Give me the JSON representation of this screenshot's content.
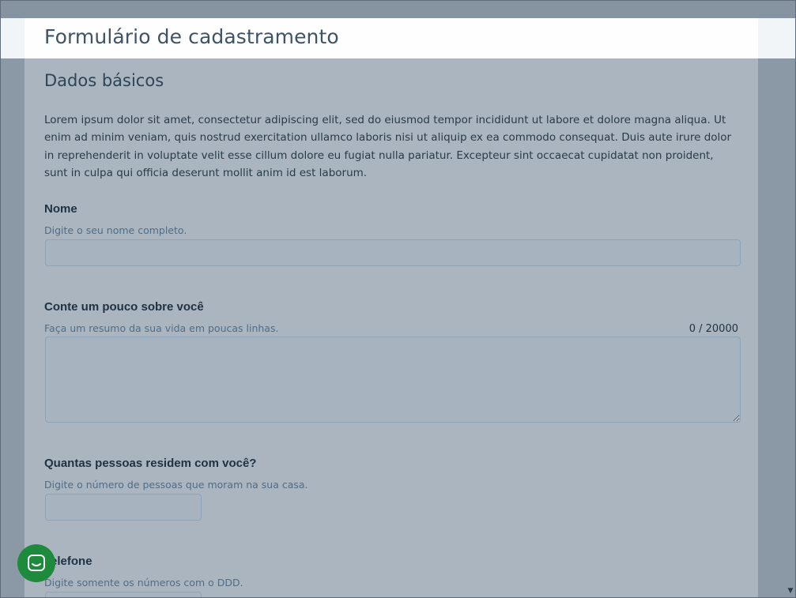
{
  "header": {
    "title": "Formulário de cadastramento"
  },
  "section": {
    "title": "Dados básicos",
    "intro": "Lorem ipsum dolor sit amet, consectetur adipiscing elit, sed do eiusmod tempor incididunt ut labore et dolore magna aliqua. Ut enim ad minim veniam, quis nostrud exercitation ullamco laboris nisi ut aliquip ex ea commodo consequat. Duis aute irure dolor in reprehenderit in voluptate velit esse cillum dolore eu fugiat nulla pariatur. Excepteur sint occaecat cupidatat non proident, sunt in culpa qui officia deserunt mollit anim id est laborum."
  },
  "fields": {
    "nome": {
      "label": "Nome",
      "help": "Digite o seu nome completo.",
      "value": ""
    },
    "sobre": {
      "label": "Conte um pouco sobre você",
      "help": "Faça um resumo da sua vida em poucas linhas.",
      "value": "",
      "counter": "0 / 20000"
    },
    "pessoas": {
      "label": "Quantas pessoas residem com você?",
      "help": "Digite o número de pessoas que moram na sua casa.",
      "value": ""
    },
    "telefone": {
      "label": "Telefone",
      "help": "Digite somente os números com o DDD.",
      "value": ""
    }
  },
  "icons": {
    "chat": "chat-bubble-icon",
    "scroll_down": "arrow-down-icon"
  },
  "colors": {
    "chat_button": "#1d8a3c",
    "title": "#3e5367"
  }
}
